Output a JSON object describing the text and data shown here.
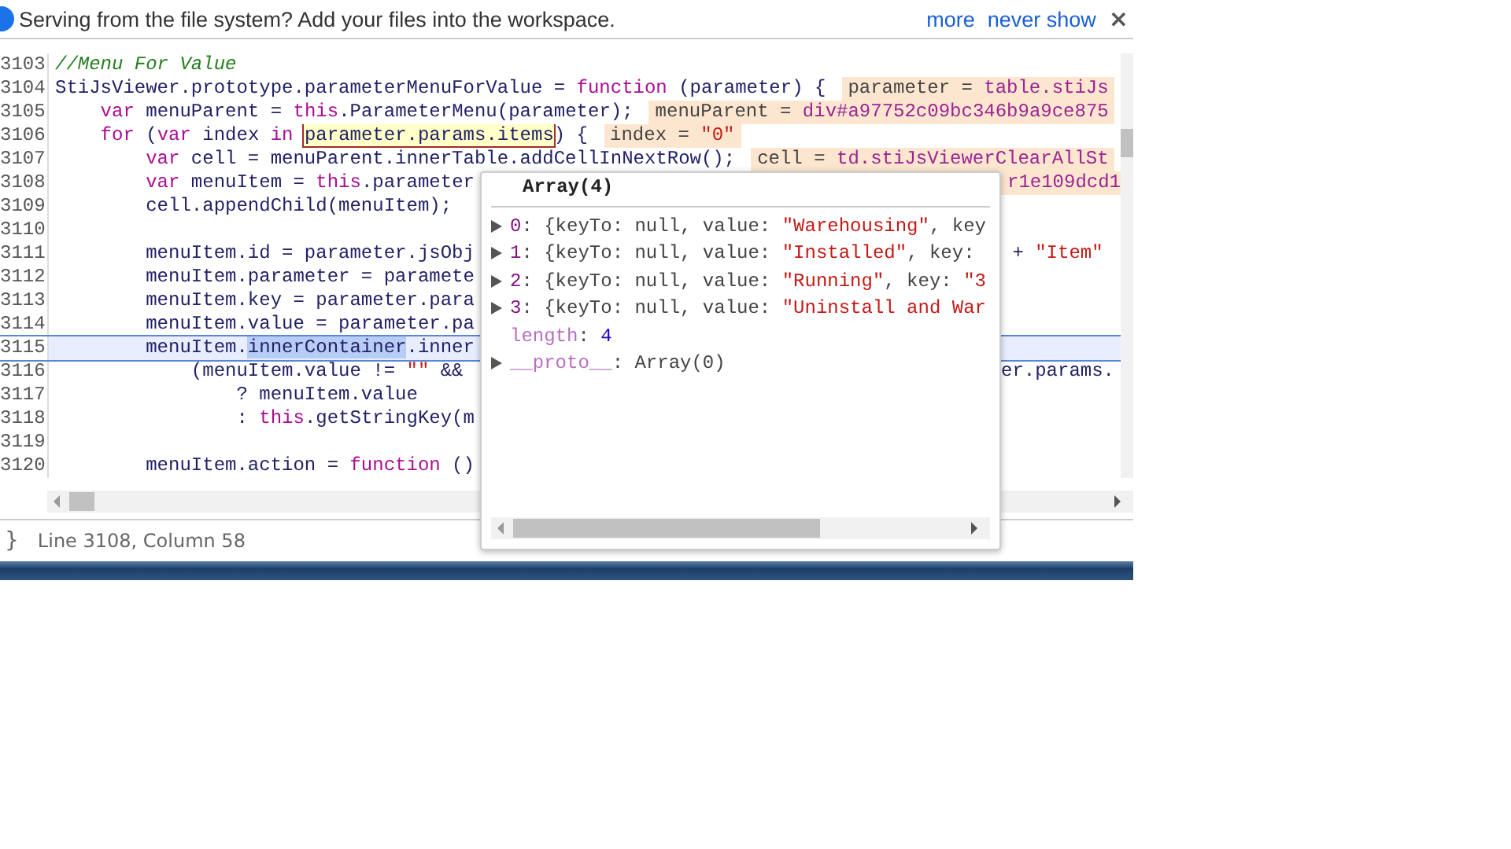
{
  "infobar": {
    "message": "Serving from the file system? Add your files into the workspace.",
    "links": [
      "more",
      "never show"
    ],
    "close": "×"
  },
  "editor": {
    "lines": [
      {
        "number": "3103",
        "highlighted": false,
        "code": [
          {
            "text": "//Menu For Value",
            "kind": "com"
          }
        ]
      },
      {
        "number": "3104",
        "highlighted": false,
        "code": [
          {
            "text": "StiJsViewer.prototype.parameterMenuForValue = ",
            "kind": "id"
          },
          {
            "text": "function",
            "kind": "kw"
          },
          {
            "text": " (parameter) {",
            "kind": "id"
          }
        ],
        "inline_value": [
          {
            "text": "parameter = ",
            "kind": "plain"
          },
          {
            "text": "table.stiJs",
            "kind": "prop"
          }
        ]
      },
      {
        "number": "3105",
        "highlighted": false,
        "code": [
          {
            "text": "    var",
            "kind": "kw"
          },
          {
            "text": " menuParent = ",
            "kind": "id"
          },
          {
            "text": "this",
            "kind": "kw"
          },
          {
            "text": ".ParameterMenu(parameter);",
            "kind": "id"
          }
        ],
        "inline_value": [
          {
            "text": "menuParent = ",
            "kind": "plain"
          },
          {
            "text": "div#a97752c09bc346b9a9ce875",
            "kind": "prop"
          }
        ]
      },
      {
        "number": "3106",
        "highlighted": false,
        "code": [
          {
            "text": "    for",
            "kind": "kw"
          },
          {
            "text": " (",
            "kind": "id"
          },
          {
            "text": "var",
            "kind": "kw"
          },
          {
            "text": " index ",
            "kind": "id"
          },
          {
            "text": "in ",
            "kind": "kw"
          },
          {
            "text": "parameter.params.items",
            "kind": "boxed"
          },
          {
            "text": ") {",
            "kind": "id"
          }
        ],
        "inline_value": [
          {
            "text": "index = ",
            "kind": "plain"
          },
          {
            "text": "\"0\"",
            "kind": "str"
          }
        ]
      },
      {
        "number": "3107",
        "highlighted": false,
        "code": [
          {
            "text": "        var",
            "kind": "kw"
          },
          {
            "text": " cell = menuParent.innerTable.addCellInNextRow();",
            "kind": "id"
          }
        ],
        "inline_value": [
          {
            "text": "cell = ",
            "kind": "plain"
          },
          {
            "text": "td.stiJsViewerClearAllSt",
            "kind": "prop"
          }
        ]
      },
      {
        "number": "3108",
        "highlighted": false,
        "code": [
          {
            "text": "        var",
            "kind": "kw"
          },
          {
            "text": " menuItem = ",
            "kind": "id"
          },
          {
            "text": "this",
            "kind": "kw"
          },
          {
            "text": ".parameter",
            "kind": "id"
          }
        ],
        "right_value": [
          {
            "text": "r1e109dcd1",
            "kind": "prop"
          }
        ]
      },
      {
        "number": "3109",
        "highlighted": false,
        "code": [
          {
            "text": "        cell.appendChild(menuItem);",
            "kind": "id"
          }
        ]
      },
      {
        "number": "3110",
        "highlighted": false
      },
      {
        "number": "3111",
        "highlighted": false,
        "code": [
          {
            "text": "        menuItem.id = parameter.jsObj",
            "kind": "id"
          }
        ],
        "right_code": [
          {
            "text": " + ",
            "kind": "id"
          },
          {
            "text": "\"Item\"",
            "kind": "str"
          }
        ]
      },
      {
        "number": "3112",
        "highlighted": false,
        "code": [
          {
            "text": "        menuItem.parameter = paramete",
            "kind": "id"
          }
        ]
      },
      {
        "number": "3113",
        "highlighted": false,
        "code": [
          {
            "text": "        menuItem.key = parameter.para",
            "kind": "id"
          }
        ]
      },
      {
        "number": "3114",
        "highlighted": false,
        "code": [
          {
            "text": "        menuItem.value = parameter.pa",
            "kind": "id"
          }
        ]
      },
      {
        "number": "3115",
        "highlighted": true,
        "code": [
          {
            "text": "        menuItem.",
            "kind": "id"
          },
          {
            "text": "innerContainer",
            "kind": "sel"
          },
          {
            "text": ".inner",
            "kind": "id"
          }
        ]
      },
      {
        "number": "3116",
        "highlighted": false,
        "code": [
          {
            "text": "            (menuItem.value != ",
            "kind": "id"
          },
          {
            "text": "\"\"",
            "kind": "str"
          },
          {
            "text": " &&",
            "kind": "id"
          }
        ],
        "right_code": [
          {
            "text": "er.params.",
            "kind": "id"
          }
        ]
      },
      {
        "number": "3117",
        "highlighted": false,
        "code": [
          {
            "text": "                ? menuItem.value",
            "kind": "id"
          }
        ]
      },
      {
        "number": "3118",
        "highlighted": false,
        "code": [
          {
            "text": "                : ",
            "kind": "id"
          },
          {
            "text": "this",
            "kind": "kw"
          },
          {
            "text": ".getStringKey(m",
            "kind": "id"
          }
        ]
      },
      {
        "number": "3119",
        "highlighted": false
      },
      {
        "number": "3120",
        "highlighted": false,
        "code": [
          {
            "text": "        menuItem.action = ",
            "kind": "id"
          },
          {
            "text": "function",
            "kind": "kw"
          },
          {
            "text": " ()",
            "kind": "id"
          }
        ]
      }
    ]
  },
  "popover": {
    "title": "Array(4)",
    "rows": [
      {
        "expandable": true,
        "tokens": [
          {
            "text": "0",
            "kind": "idx"
          },
          {
            "text": ": {keyTo: null, value: ",
            "kind": "plain"
          },
          {
            "text": "\"Warehousing\"",
            "kind": "str"
          },
          {
            "text": ", key",
            "kind": "plain"
          }
        ]
      },
      {
        "expandable": true,
        "tokens": [
          {
            "text": "1",
            "kind": "idx"
          },
          {
            "text": ": {keyTo: null, value: ",
            "kind": "plain"
          },
          {
            "text": "\"Installed\"",
            "kind": "str"
          },
          {
            "text": ", key:",
            "kind": "plain"
          }
        ]
      },
      {
        "expandable": true,
        "tokens": [
          {
            "text": "2",
            "kind": "idx"
          },
          {
            "text": ": {keyTo: null, value: ",
            "kind": "plain"
          },
          {
            "text": "\"Running\"",
            "kind": "str"
          },
          {
            "text": ", key: ",
            "kind": "plain"
          },
          {
            "text": "\"3",
            "kind": "str"
          }
        ]
      },
      {
        "expandable": true,
        "tokens": [
          {
            "text": "3",
            "kind": "idx"
          },
          {
            "text": ": {keyTo: null, value: ",
            "kind": "plain"
          },
          {
            "text": "\"Uninstall and War",
            "kind": "str"
          }
        ]
      },
      {
        "expandable": false,
        "tokens": [
          {
            "text": "length",
            "kind": "key"
          },
          {
            "text": ": ",
            "kind": "plain"
          },
          {
            "text": "4",
            "kind": "num"
          }
        ]
      },
      {
        "expandable": true,
        "tokens": [
          {
            "text": "__proto__",
            "kind": "key"
          },
          {
            "text": ": Array(0)",
            "kind": "plain"
          }
        ]
      }
    ]
  },
  "status_bar": {
    "format_icon": "}",
    "position": "Line 3108, Column 58"
  }
}
